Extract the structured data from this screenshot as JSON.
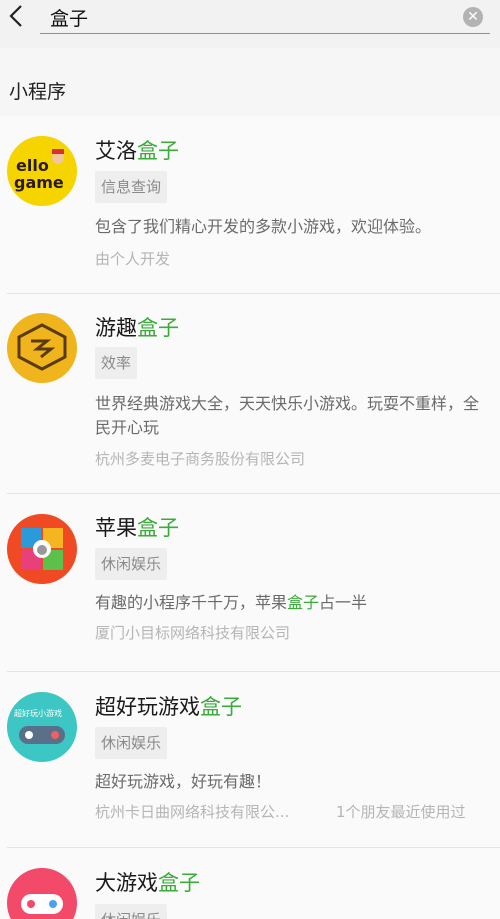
{
  "search": {
    "query": "盒子",
    "back_icon": "chevron-left-icon",
    "clear_icon": "clear-x-icon",
    "accent_color": "#4fbf4f"
  },
  "section": {
    "title": "小程序"
  },
  "highlight_color": "#3bab3b",
  "results": [
    {
      "name_prefix": "艾洛",
      "name_highlight": "盒子",
      "tag": "信息查询",
      "description": "包含了我们精心开发的多款小游戏，欢迎体验。",
      "developer": "由个人开发",
      "icon_text_1": "ello",
      "icon_text_2": "game"
    },
    {
      "name_prefix": "游趣",
      "name_highlight": "盒子",
      "tag": "效率",
      "description": "世界经典游戏大全，天天快乐小游戏。玩耍不重样，全民开心玩",
      "developer": "杭州多麦电子商务股份有限公司"
    },
    {
      "name_prefix": "苹果",
      "name_highlight": "盒子",
      "tag": "休闲娱乐",
      "description_before": "有趣的小程序千千万，苹果",
      "description_highlight": "盒子",
      "description_after": "占一半",
      "developer": "厦门小目标网络科技有限公司"
    },
    {
      "name_prefix": "超好玩游戏",
      "name_highlight": "盒子",
      "tag": "休闲娱乐",
      "description": "超好玩游戏，好玩有趣！",
      "developer": "杭州卡日曲网络科技有限公...",
      "friends_note": "1个朋友最近使用过",
      "icon_text": "超好玩小游戏"
    },
    {
      "name_prefix": "大游戏",
      "name_highlight": "盒子",
      "tag": "休闲娱乐"
    }
  ]
}
